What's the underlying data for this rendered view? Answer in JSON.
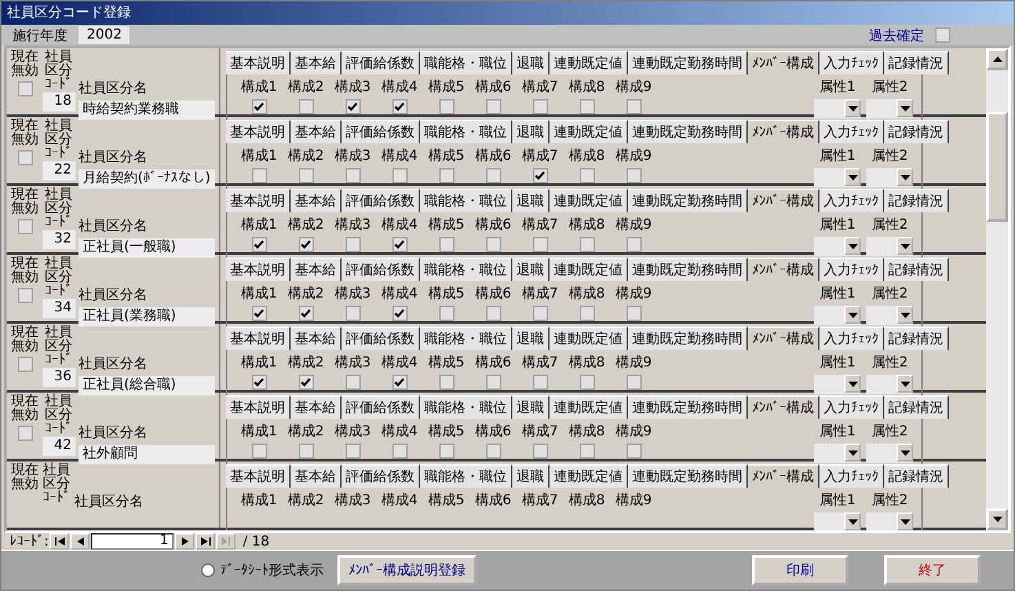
{
  "window": {
    "title": "社員区分コード登録"
  },
  "header": {
    "year_label": "施行年度",
    "year": "2002",
    "past_label": "過去確定",
    "past_confirmed": false
  },
  "rows": [
    {
      "invalid_label": "現在無効",
      "code_label": "社員区分ｺｰﾄﾞ",
      "name_label": "社員区分名",
      "invalid": false,
      "code": "18",
      "name": "時給契約業務職",
      "tabs": [
        {
          "label": "基本説明",
          "selected": false
        },
        {
          "label": "基本給",
          "selected": false
        },
        {
          "label": "評価給係数",
          "selected": false
        },
        {
          "label": "職能格・職位",
          "selected": false
        },
        {
          "label": "退職",
          "selected": false
        },
        {
          "label": "連動既定値",
          "selected": false
        },
        {
          "label": "連動既定勤務時間",
          "selected": false
        },
        {
          "label": "ﾒﾝﾊﾞｰ構成",
          "selected": true
        },
        {
          "label": "入力ﾁｪｯｸ",
          "selected": false
        },
        {
          "label": "記録情況",
          "selected": false
        }
      ],
      "members": [
        {
          "label": "構成1",
          "checked": true
        },
        {
          "label": "構成2",
          "checked": false
        },
        {
          "label": "構成3",
          "checked": true
        },
        {
          "label": "構成4",
          "checked": true
        },
        {
          "label": "構成5",
          "checked": false
        },
        {
          "label": "構成6",
          "checked": false
        },
        {
          "label": "構成7",
          "checked": false
        },
        {
          "label": "構成8",
          "checked": false
        },
        {
          "label": "構成9",
          "checked": false
        }
      ],
      "attributes": [
        {
          "label": "属性1"
        },
        {
          "label": "属性2"
        }
      ]
    },
    {
      "invalid_label": "現在無効",
      "code_label": "社員区分ｺｰﾄﾞ",
      "name_label": "社員区分名",
      "invalid": false,
      "code": "22",
      "name": "月給契約(ﾎﾞｰﾅｽなし)",
      "tabs": [
        {
          "label": "基本説明",
          "selected": false
        },
        {
          "label": "基本給",
          "selected": false
        },
        {
          "label": "評価給係数",
          "selected": false
        },
        {
          "label": "職能格・職位",
          "selected": false
        },
        {
          "label": "退職",
          "selected": false
        },
        {
          "label": "連動既定値",
          "selected": false
        },
        {
          "label": "連動既定勤務時間",
          "selected": false
        },
        {
          "label": "ﾒﾝﾊﾞｰ構成",
          "selected": true
        },
        {
          "label": "入力ﾁｪｯｸ",
          "selected": false
        },
        {
          "label": "記録情況",
          "selected": false
        }
      ],
      "members": [
        {
          "label": "構成1",
          "checked": false
        },
        {
          "label": "構成2",
          "checked": false
        },
        {
          "label": "構成3",
          "checked": false
        },
        {
          "label": "構成4",
          "checked": false
        },
        {
          "label": "構成5",
          "checked": false
        },
        {
          "label": "構成6",
          "checked": false
        },
        {
          "label": "構成7",
          "checked": true
        },
        {
          "label": "構成8",
          "checked": false
        },
        {
          "label": "構成9",
          "checked": false
        }
      ],
      "attributes": [
        {
          "label": "属性1"
        },
        {
          "label": "属性2"
        }
      ]
    },
    {
      "invalid_label": "現在無効",
      "code_label": "社員区分ｺｰﾄﾞ",
      "name_label": "社員区分名",
      "invalid": false,
      "code": "32",
      "name": "正社員(一般職)",
      "tabs": [
        {
          "label": "基本説明",
          "selected": false
        },
        {
          "label": "基本給",
          "selected": false
        },
        {
          "label": "評価給係数",
          "selected": false
        },
        {
          "label": "職能格・職位",
          "selected": false
        },
        {
          "label": "退職",
          "selected": false
        },
        {
          "label": "連動既定値",
          "selected": false
        },
        {
          "label": "連動既定勤務時間",
          "selected": false
        },
        {
          "label": "ﾒﾝﾊﾞｰ構成",
          "selected": true
        },
        {
          "label": "入力ﾁｪｯｸ",
          "selected": false
        },
        {
          "label": "記録情況",
          "selected": false
        }
      ],
      "members": [
        {
          "label": "構成1",
          "checked": true
        },
        {
          "label": "構成2",
          "checked": true
        },
        {
          "label": "構成3",
          "checked": false
        },
        {
          "label": "構成4",
          "checked": true
        },
        {
          "label": "構成5",
          "checked": false
        },
        {
          "label": "構成6",
          "checked": false
        },
        {
          "label": "構成7",
          "checked": false
        },
        {
          "label": "構成8",
          "checked": false
        },
        {
          "label": "構成9",
          "checked": false
        }
      ],
      "attributes": [
        {
          "label": "属性1"
        },
        {
          "label": "属性2"
        }
      ]
    },
    {
      "invalid_label": "現在無効",
      "code_label": "社員区分ｺｰﾄﾞ",
      "name_label": "社員区分名",
      "invalid": false,
      "code": "34",
      "name": "正社員(業務職)",
      "tabs": [
        {
          "label": "基本説明",
          "selected": false
        },
        {
          "label": "基本給",
          "selected": false
        },
        {
          "label": "評価給係数",
          "selected": false
        },
        {
          "label": "職能格・職位",
          "selected": false
        },
        {
          "label": "退職",
          "selected": false
        },
        {
          "label": "連動既定値",
          "selected": false
        },
        {
          "label": "連動既定勤務時間",
          "selected": false
        },
        {
          "label": "ﾒﾝﾊﾞｰ構成",
          "selected": true
        },
        {
          "label": "入力ﾁｪｯｸ",
          "selected": false
        },
        {
          "label": "記録情況",
          "selected": false
        }
      ],
      "members": [
        {
          "label": "構成1",
          "checked": true
        },
        {
          "label": "構成2",
          "checked": true
        },
        {
          "label": "構成3",
          "checked": false
        },
        {
          "label": "構成4",
          "checked": true
        },
        {
          "label": "構成5",
          "checked": false
        },
        {
          "label": "構成6",
          "checked": false
        },
        {
          "label": "構成7",
          "checked": false
        },
        {
          "label": "構成8",
          "checked": false
        },
        {
          "label": "構成9",
          "checked": false
        }
      ],
      "attributes": [
        {
          "label": "属性1"
        },
        {
          "label": "属性2"
        }
      ]
    },
    {
      "invalid_label": "現在無効",
      "code_label": "社員区分ｺｰﾄﾞ",
      "name_label": "社員区分名",
      "invalid": false,
      "code": "36",
      "name": "正社員(総合職)",
      "tabs": [
        {
          "label": "基本説明",
          "selected": false
        },
        {
          "label": "基本給",
          "selected": false
        },
        {
          "label": "評価給係数",
          "selected": false
        },
        {
          "label": "職能格・職位",
          "selected": false
        },
        {
          "label": "退職",
          "selected": false
        },
        {
          "label": "連動既定値",
          "selected": false
        },
        {
          "label": "連動既定勤務時間",
          "selected": false
        },
        {
          "label": "ﾒﾝﾊﾞｰ構成",
          "selected": true
        },
        {
          "label": "入力ﾁｪｯｸ",
          "selected": false
        },
        {
          "label": "記録情況",
          "selected": false
        }
      ],
      "members": [
        {
          "label": "構成1",
          "checked": true
        },
        {
          "label": "構成2",
          "checked": true
        },
        {
          "label": "構成3",
          "checked": false
        },
        {
          "label": "構成4",
          "checked": true
        },
        {
          "label": "構成5",
          "checked": false
        },
        {
          "label": "構成6",
          "checked": false
        },
        {
          "label": "構成7",
          "checked": false
        },
        {
          "label": "構成8",
          "checked": false
        },
        {
          "label": "構成9",
          "checked": false
        }
      ],
      "attributes": [
        {
          "label": "属性1"
        },
        {
          "label": "属性2"
        }
      ]
    },
    {
      "invalid_label": "現在無効",
      "code_label": "社員区分ｺｰﾄﾞ",
      "name_label": "社員区分名",
      "invalid": false,
      "code": "42",
      "name": "社外顧問",
      "tabs": [
        {
          "label": "基本説明",
          "selected": false
        },
        {
          "label": "基本給",
          "selected": false
        },
        {
          "label": "評価給係数",
          "selected": false
        },
        {
          "label": "職能格・職位",
          "selected": false
        },
        {
          "label": "退職",
          "selected": false
        },
        {
          "label": "連動既定値",
          "selected": false
        },
        {
          "label": "連動既定勤務時間",
          "selected": false
        },
        {
          "label": "ﾒﾝﾊﾞｰ構成",
          "selected": true
        },
        {
          "label": "入力ﾁｪｯｸ",
          "selected": false
        },
        {
          "label": "記録情況",
          "selected": false
        }
      ],
      "members": [
        {
          "label": "構成1",
          "checked": false
        },
        {
          "label": "構成2",
          "checked": false
        },
        {
          "label": "構成3",
          "checked": false
        },
        {
          "label": "構成4",
          "checked": false
        },
        {
          "label": "構成5",
          "checked": false
        },
        {
          "label": "構成6",
          "checked": false
        },
        {
          "label": "構成7",
          "checked": false
        },
        {
          "label": "構成8",
          "checked": false
        },
        {
          "label": "構成9",
          "checked": false
        }
      ],
      "attributes": [
        {
          "label": "属性1"
        },
        {
          "label": "属性2"
        }
      ]
    },
    {
      "invalid_label": "現在無効",
      "code_label": "社員区分ｺｰﾄﾞ",
      "name_label": "社員区分名",
      "members": [
        {
          "label": "構成1"
        },
        {
          "label": "構成2"
        },
        {
          "label": "構成3"
        },
        {
          "label": "構成4"
        },
        {
          "label": "構成5"
        },
        {
          "label": "構成6"
        },
        {
          "label": "構成7"
        },
        {
          "label": "構成8"
        },
        {
          "label": "構成9"
        }
      ],
      "attributes": [
        {
          "label": "属性1"
        },
        {
          "label": "属性2"
        }
      ],
      "tabs": [
        {
          "label": "基本説明",
          "selected": false
        },
        {
          "label": "基本給",
          "selected": false
        },
        {
          "label": "評価給係数",
          "selected": false
        },
        {
          "label": "職能格・職位",
          "selected": false
        },
        {
          "label": "退職",
          "selected": false
        },
        {
          "label": "連動既定値",
          "selected": false
        },
        {
          "label": "連動既定勤務時間",
          "selected": false
        },
        {
          "label": "ﾒﾝﾊﾞｰ構成",
          "selected": true
        },
        {
          "label": "入力ﾁｪｯｸ",
          "selected": false
        },
        {
          "label": "記録情況",
          "selected": false
        }
      ]
    }
  ],
  "navigator": {
    "label": "ﾚｺｰﾄﾞ:",
    "current": "1",
    "total": "/ 18"
  },
  "footer": {
    "radio_label": "ﾃﾞｰﾀｼｰﾄ形式表示",
    "radio_selected": false,
    "buttons": [
      {
        "label": "ﾒﾝﾊﾞｰ構成説明登録",
        "kind": "normal"
      },
      {
        "label": "印刷",
        "kind": "print"
      },
      {
        "label": "終了",
        "kind": "exit"
      }
    ]
  }
}
